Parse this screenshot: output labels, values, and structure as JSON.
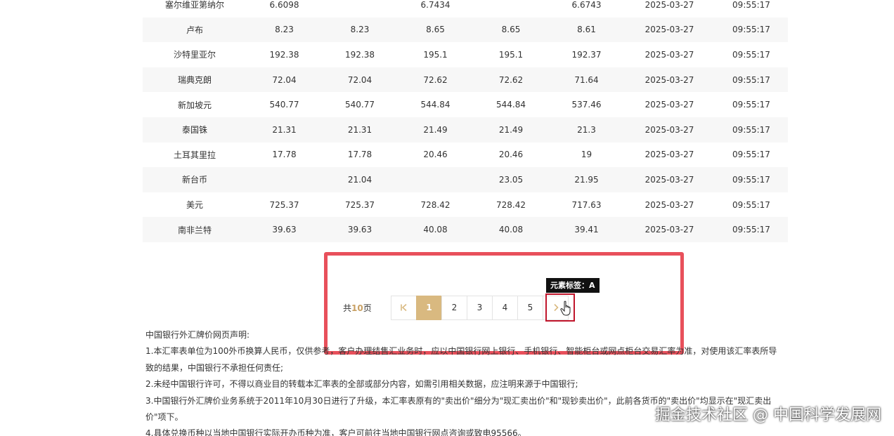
{
  "table": {
    "rows": [
      [
        "塞尔维亚第纳尔",
        "6.6098",
        "",
        "6.7434",
        "",
        "6.6743",
        "2025-03-27",
        "09:55:17"
      ],
      [
        "卢布",
        "8.23",
        "8.23",
        "8.65",
        "8.65",
        "8.61",
        "2025-03-27",
        "09:55:17"
      ],
      [
        "沙特里亚尔",
        "192.38",
        "192.38",
        "195.1",
        "195.1",
        "192.37",
        "2025-03-27",
        "09:55:17"
      ],
      [
        "瑞典克朗",
        "72.04",
        "72.04",
        "72.62",
        "72.62",
        "71.64",
        "2025-03-27",
        "09:55:17"
      ],
      [
        "新加坡元",
        "540.77",
        "540.77",
        "544.84",
        "544.84",
        "537.46",
        "2025-03-27",
        "09:55:17"
      ],
      [
        "泰国铢",
        "21.31",
        "21.31",
        "21.49",
        "21.49",
        "21.3",
        "2025-03-27",
        "09:55:17"
      ],
      [
        "土耳其里拉",
        "17.78",
        "17.78",
        "20.46",
        "20.46",
        "19",
        "2025-03-27",
        "09:55:17"
      ],
      [
        "新台币",
        "",
        "21.04",
        "",
        "23.05",
        "21.95",
        "2025-03-27",
        "09:55:17"
      ],
      [
        "美元",
        "725.37",
        "725.37",
        "728.42",
        "728.42",
        "717.63",
        "2025-03-27",
        "09:55:17"
      ],
      [
        "南非兰特",
        "39.63",
        "39.63",
        "40.08",
        "40.08",
        "39.41",
        "2025-03-27",
        "09:55:17"
      ]
    ]
  },
  "pagination": {
    "total_prefix": "共",
    "total_pages": "10",
    "total_suffix": "页",
    "first_label": "K",
    "pages": [
      "1",
      "2",
      "3",
      "4",
      "5"
    ],
    "active_page": "1",
    "next_label": "›"
  },
  "annotation": {
    "element_tag": "元素标签：A",
    "highlight_color": "#e8505b",
    "target_color": "#c0152b"
  },
  "notice": {
    "title": "中国银行外汇牌价网页声明:",
    "items": [
      "1.本汇率表单位为100外币换算人民币，仅供参考，客户办理结售汇业务时，应以中国银行网上银行、手机银行、智能柜台或网点柜台交易汇率为准，对使用该汇率表所导致的结果，中国银行不承担任何责任;",
      "2.未经中国银行许可，不得以商业目的转载本汇率表的全部或部分内容，如需引用相关数据，应注明来源于中国银行;",
      "3.中国银行外汇牌价业务系统于2011年10月30日进行了升级，本汇率表原有的\"卖出价\"细分为\"现汇卖出价\"和\"现钞卖出价\"，此前各货币的\"卖出价\"均显示在\"现汇卖出价\"项下。",
      "4.具体兑换币种以当地中国银行实际开办币种为准，客户可前往当地中国银行网点咨询或致电95566。"
    ]
  },
  "watermark": {
    "text": "掘金技术社区 @ 中国科学发展网"
  },
  "colors": {
    "accent": "#d9b980",
    "total_number": "#c8a063",
    "row_stripe": "#f7f7f7"
  }
}
